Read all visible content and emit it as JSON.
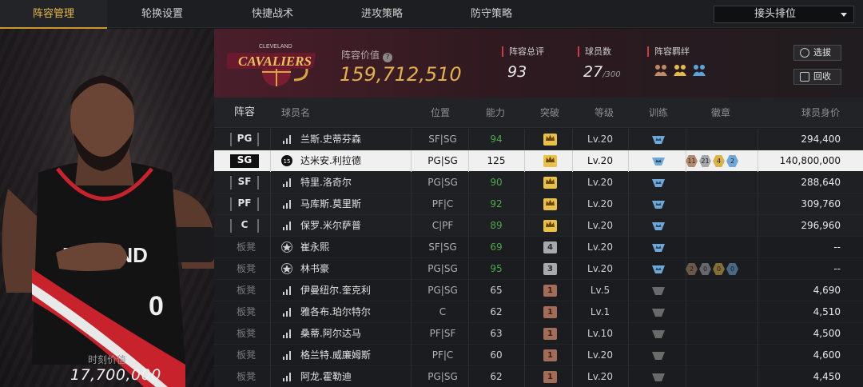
{
  "nav": {
    "tabs": [
      {
        "label": "阵容管理",
        "active": true
      },
      {
        "label": "轮换设置",
        "active": false
      },
      {
        "label": "快捷战术",
        "active": false
      },
      {
        "label": "进攻策略",
        "active": false
      },
      {
        "label": "防守策略",
        "active": false
      }
    ],
    "dropdown": {
      "selected": "接头排位"
    }
  },
  "player_panel": {
    "value_label": "时刻价值",
    "value": "17,700,000",
    "jersey": {
      "text": "RTLAND",
      "number": "0"
    }
  },
  "team": {
    "logo_text": "CAVALIERS",
    "logo_subtext": "CLEVELAND",
    "lineup_value_label": "阵容价值",
    "lineup_value": "159,712,510",
    "stats": {
      "overall_label": "阵容总评",
      "overall_value": "93",
      "players_label": "球员数",
      "players_value": "27",
      "players_max": "/300",
      "bonds_label": "阵容羁绊"
    },
    "buttons": {
      "pick": "选拔",
      "recycle": "回收"
    }
  },
  "table": {
    "headers": [
      "阵容",
      "球员名",
      "位置",
      "能力",
      "突破",
      "等级",
      "训练",
      "徽章",
      "球员身价"
    ],
    "rows": [
      {
        "slot": "PG",
        "bench": false,
        "name": "兰斯.史蒂芬森",
        "pos": "SF|SG",
        "ability": "94",
        "ability_color": "green",
        "breakthrough": "crown",
        "breakthrough_tier": "gold",
        "level": "Lv.20",
        "train": "blue",
        "badges": [],
        "price": "294,400",
        "selected": false
      },
      {
        "slot": "SG",
        "bench": false,
        "name": "达米安.利拉德",
        "pos": "PG|SG",
        "ability": "125",
        "ability_color": "gray",
        "breakthrough": "crown",
        "breakthrough_tier": "gold",
        "level": "Lv.20",
        "train": "blue",
        "badges": [
          {
            "v": "11",
            "t": "b"
          },
          {
            "v": "21",
            "t": "s"
          },
          {
            "v": "4",
            "t": "g"
          },
          {
            "v": "2",
            "t": "p"
          }
        ],
        "price": "140,800,000",
        "selected": true,
        "icon": "15"
      },
      {
        "slot": "SF",
        "bench": false,
        "name": "特里.洛奇尔",
        "pos": "PG|SG",
        "ability": "90",
        "ability_color": "green",
        "breakthrough": "crown",
        "breakthrough_tier": "gold",
        "level": "Lv.20",
        "train": "blue",
        "badges": [],
        "price": "288,640",
        "selected": false
      },
      {
        "slot": "PF",
        "bench": false,
        "name": "马库斯.莫里斯",
        "pos": "PF|C",
        "ability": "92",
        "ability_color": "green",
        "breakthrough": "crown",
        "breakthrough_tier": "gold",
        "level": "Lv.20",
        "train": "blue",
        "badges": [],
        "price": "309,760",
        "selected": false
      },
      {
        "slot": "C",
        "bench": false,
        "name": "保罗.米尔萨普",
        "pos": "C|PF",
        "ability": "89",
        "ability_color": "green",
        "breakthrough": "crown",
        "breakthrough_tier": "gold",
        "level": "Lv.20",
        "train": "blue",
        "badges": [],
        "price": "296,960",
        "selected": false
      },
      {
        "slot": "板凳",
        "bench": true,
        "name": "崔永熙",
        "pos": "SF|SG",
        "ability": "69",
        "ability_color": "green",
        "breakthrough": "4",
        "breakthrough_tier": "silver",
        "level": "Lv.20",
        "train": "blue",
        "badges": [],
        "price": "--",
        "selected": false,
        "icon": "star"
      },
      {
        "slot": "板凳",
        "bench": true,
        "name": "林书豪",
        "pos": "PG|SG",
        "ability": "95",
        "ability_color": "green",
        "breakthrough": "3",
        "breakthrough_tier": "silver",
        "level": "Lv.20",
        "train": "blue",
        "badges": [
          {
            "v": "2",
            "t": "b"
          },
          {
            "v": "0",
            "t": "s"
          },
          {
            "v": "0",
            "t": "g"
          },
          {
            "v": "0",
            "t": "p"
          }
        ],
        "price": "--",
        "selected": false,
        "icon": "star"
      },
      {
        "slot": "板凳",
        "bench": true,
        "name": "伊曼纽尔.奎克利",
        "pos": "PG|SG",
        "ability": "65",
        "ability_color": "gray",
        "breakthrough": "1",
        "breakthrough_tier": "bronze",
        "level": "Lv.5",
        "train": "gray",
        "badges": [],
        "price": "4,690",
        "selected": false
      },
      {
        "slot": "板凳",
        "bench": true,
        "name": "雅各布.珀尔特尔",
        "pos": "C",
        "ability": "62",
        "ability_color": "gray",
        "breakthrough": "1",
        "breakthrough_tier": "bronze",
        "level": "Lv.1",
        "train": "gray",
        "badges": [],
        "price": "4,510",
        "selected": false
      },
      {
        "slot": "板凳",
        "bench": true,
        "name": "桑蒂.阿尔达马",
        "pos": "PF|SF",
        "ability": "63",
        "ability_color": "gray",
        "breakthrough": "1",
        "breakthrough_tier": "bronze",
        "level": "Lv.10",
        "train": "gray",
        "badges": [],
        "price": "4,500",
        "selected": false
      },
      {
        "slot": "板凳",
        "bench": true,
        "name": "格兰特.威廉姆斯",
        "pos": "PF|C",
        "ability": "60",
        "ability_color": "gray",
        "breakthrough": "1",
        "breakthrough_tier": "bronze",
        "level": "Lv.20",
        "train": "gray",
        "badges": [],
        "price": "4,600",
        "selected": false
      },
      {
        "slot": "板凳",
        "bench": true,
        "name": "阿龙.霍勒迪",
        "pos": "PG|SG",
        "ability": "62",
        "ability_color": "gray",
        "breakthrough": "1",
        "breakthrough_tier": "bronze",
        "level": "Lv.20",
        "train": "gray",
        "badges": [],
        "price": "4,450",
        "selected": false
      }
    ]
  },
  "colors": {
    "accent_gold": "#e4b04a",
    "ability_green": "#4da94a",
    "stat_marker_red": "#d03a3a",
    "train_blue": "#6fa8d8"
  }
}
